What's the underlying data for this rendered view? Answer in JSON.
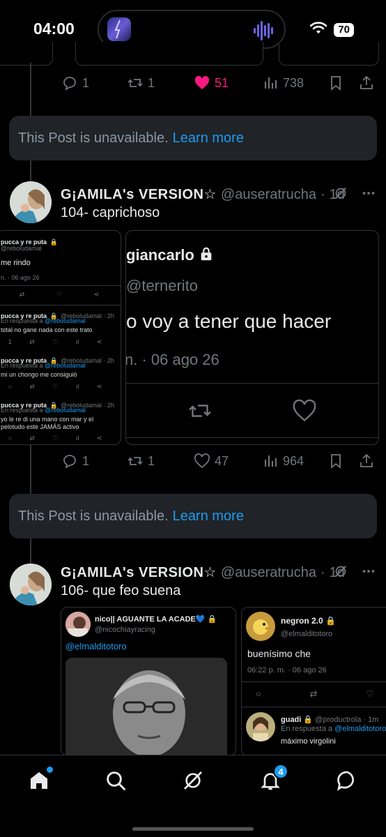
{
  "status_bar": {
    "time": "04:00",
    "battery": "70",
    "icons": [
      "music-app-icon",
      "audio-wave-icon",
      "wifi-icon",
      "battery-icon"
    ]
  },
  "post1_actions": {
    "replies": "1",
    "reposts": "1",
    "likes": "51",
    "views": "738"
  },
  "unavailable1": {
    "text": "This Post is unavailable.",
    "link": "Learn more"
  },
  "tweet1": {
    "name": "G¡AMILA's VERSION☆",
    "handle": "@auseratrucha",
    "time": "1d",
    "text": "104- caprichoso",
    "actions": {
      "replies": "1",
      "reposts": "1",
      "likes": "47",
      "views": "964"
    }
  },
  "shot_left": {
    "top_name": "pucca y re puta",
    "top_handle": "@reboludamal",
    "top_text": "me rindo",
    "top_date": "n. · 06 ago 26",
    "replies": [
      {
        "name": "pucca y re puta",
        "handle": "@reboludamal · 2h",
        "reply_prefix": "En respuesta a",
        "reply_to": "@reboludamal",
        "text": "total no gane nada con este trato"
      },
      {
        "name": "pucca y re puta",
        "handle": "@reboludamal · 2h",
        "reply_prefix": "En respuesta a",
        "reply_to": "@reboludamal",
        "text": "mi un chongo me consiguió"
      },
      {
        "name": "pucca y re puta",
        "handle": "@reboludamal · 2h",
        "reply_prefix": "En respuesta a",
        "reply_to": "@reboludamal",
        "text": "yo le re di una mano con mar y el pelotudo este JAMÁS activo"
      }
    ],
    "counts": [
      "1",
      "1"
    ]
  },
  "shot_right": {
    "name": "giancarlo",
    "handle": "@ternerito",
    "text": "o voy a tener que hacer",
    "date": "n. · 06 ago 26"
  },
  "unavailable2": {
    "text": "This Post is unavailable.",
    "link": "Learn more"
  },
  "tweet2": {
    "name": "G¡AMILA's VERSION☆",
    "handle": "@auseratrucha",
    "time": "1d",
    "text": "106- que feo suena"
  },
  "shot3": {
    "name": "nico|| AGUANTE LA ACADE💙",
    "handle": "@nicochiayracing",
    "mention": "@elmalditotoro"
  },
  "shot4": {
    "name": "negron 2.0",
    "handle": "@elmalditotoro",
    "text": "buenísimo che",
    "date": "06:22 p. m. · 06 ago 26",
    "reply_name": "guadi",
    "reply_handle": "@productrola · 1m",
    "reply_prefix": "En respuesta a",
    "reply_to": "@elmalditotoro",
    "reply_text": "máximo virgolini"
  },
  "bottom_nav": {
    "notifications_badge": "4",
    "items": [
      "home-icon",
      "search-icon",
      "grok-icon",
      "notifications-icon",
      "messages-icon"
    ]
  }
}
